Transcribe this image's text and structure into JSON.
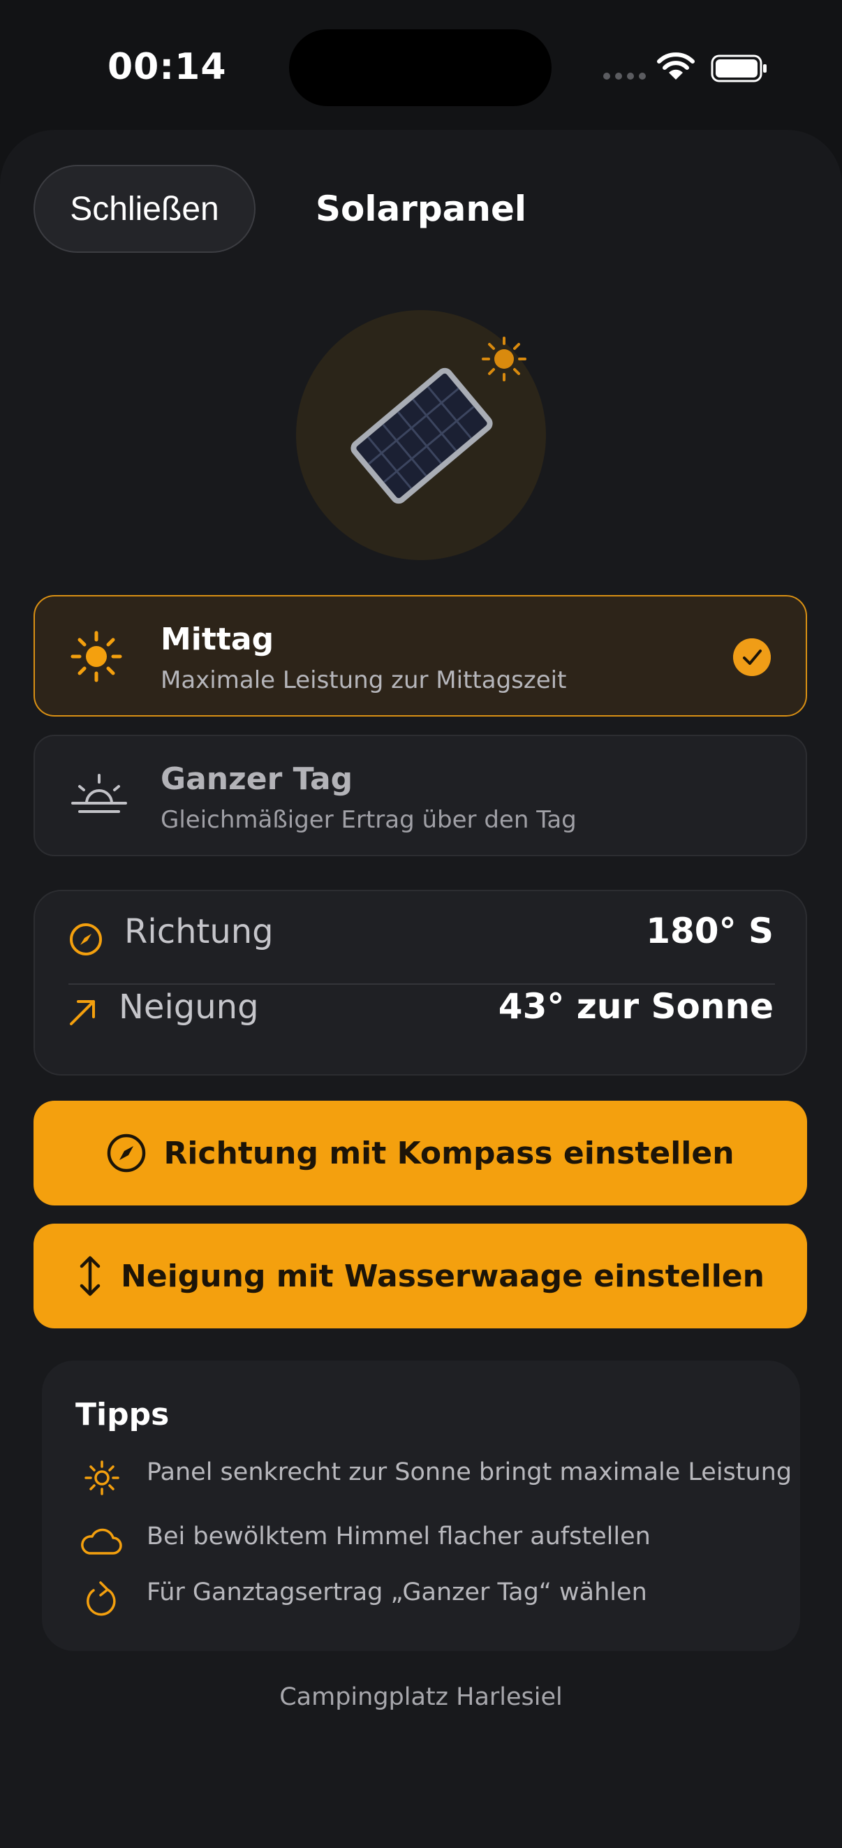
{
  "status_bar": {
    "time": "00:14"
  },
  "header": {
    "close_label": "Schließen",
    "title": "Solarpanel"
  },
  "modes": [
    {
      "title": "Mittag",
      "subtitle": "Maximale Leistung zur Mittagszeit",
      "selected": true,
      "icon": "sun-icon"
    },
    {
      "title": "Ganzer Tag",
      "subtitle": "Gleichmäßiger Ertrag über den Tag",
      "selected": false,
      "icon": "sunrise-icon"
    }
  ],
  "info": {
    "direction_label": "Richtung",
    "direction_value": "180° S",
    "tilt_label": "Neigung",
    "tilt_value": "43° zur Sonne"
  },
  "actions": {
    "compass_label": "Richtung mit Kompass einstellen",
    "level_label": "Neigung mit Wasserwaage einstellen"
  },
  "tips": {
    "title": "Tipps",
    "items": [
      {
        "icon": "sun-icon",
        "text": "Panel senkrecht zur Sonne bringt maximale Leistung"
      },
      {
        "icon": "cloud-icon",
        "text": "Bei bewölktem Himmel flacher aufstellen"
      },
      {
        "icon": "refresh-icon",
        "text": "Für Ganztagsertrag „Ganzer Tag“ wählen"
      }
    ]
  },
  "footer": {
    "location": "Campingplatz Harlesiel"
  },
  "colors": {
    "accent": "#f4a00e",
    "background": "#121315",
    "card": "#1f2024"
  }
}
